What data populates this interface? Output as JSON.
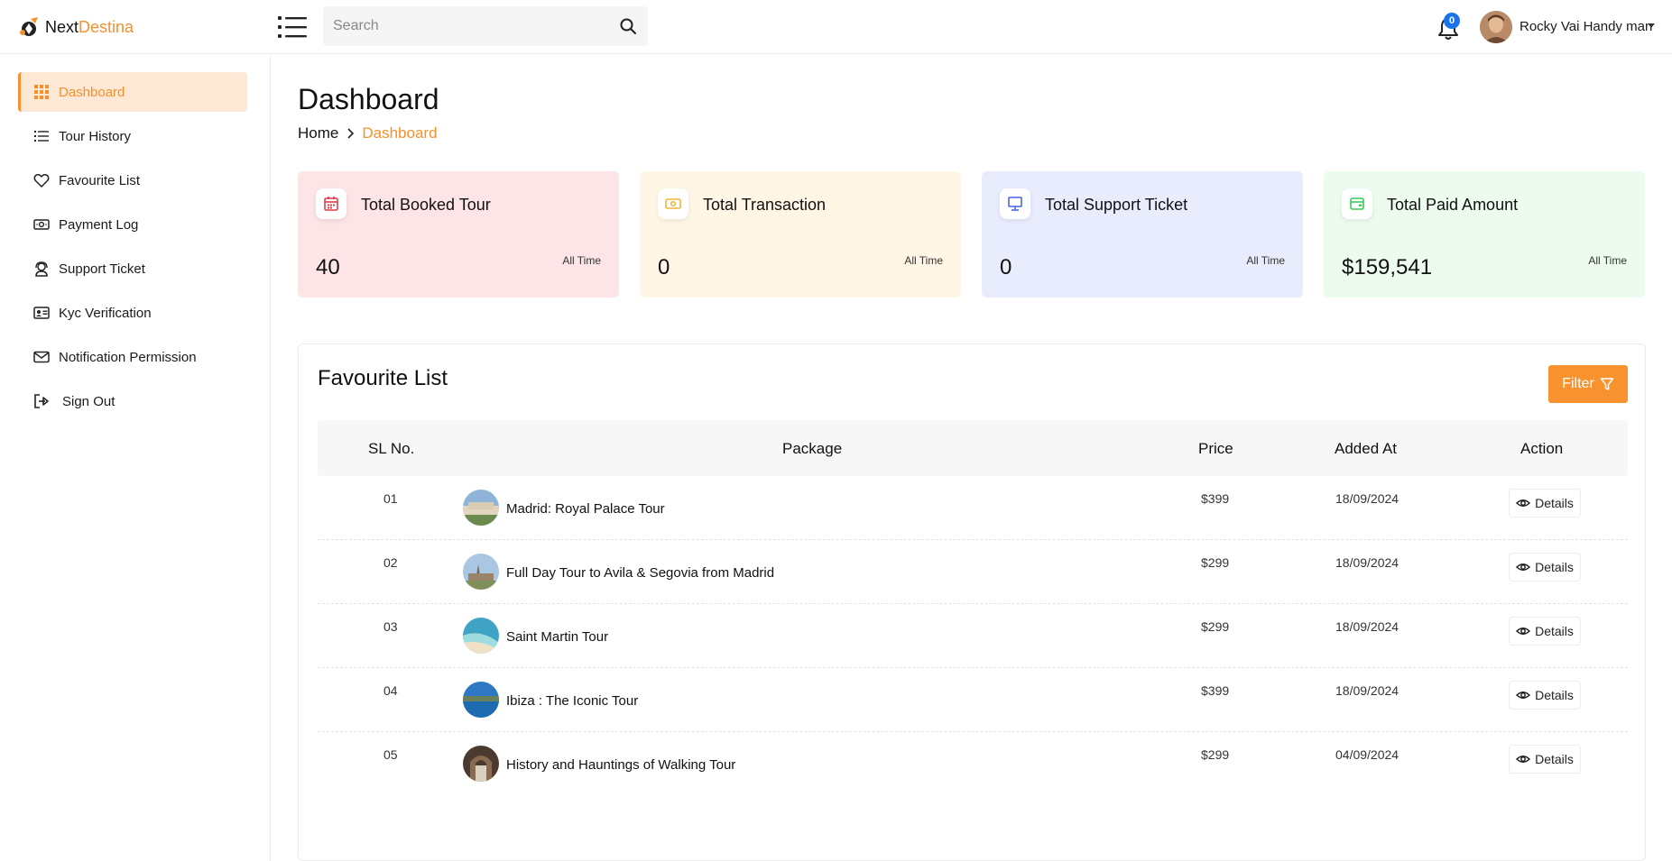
{
  "brand": {
    "part1": "Next",
    "part2": "Destina"
  },
  "search": {
    "placeholder": "Search"
  },
  "notifications": {
    "count": "0"
  },
  "user": {
    "name": "Rocky Vai Handy man"
  },
  "sidebar": {
    "items": [
      {
        "label": "Dashboard",
        "icon": "grid-icon",
        "active": true
      },
      {
        "label": "Tour History",
        "icon": "list-icon"
      },
      {
        "label": "Favourite List",
        "icon": "heart-icon"
      },
      {
        "label": "Payment Log",
        "icon": "money-icon"
      },
      {
        "label": "Support Ticket",
        "icon": "support-icon"
      },
      {
        "label": "Kyc Verification",
        "icon": "id-card-icon"
      },
      {
        "label": "Notification Permission",
        "icon": "envelope-icon"
      },
      {
        "label": "Sign Out",
        "icon": "sign-out-icon"
      }
    ]
  },
  "page": {
    "title": "Dashboard"
  },
  "breadcrumb": {
    "home": "Home",
    "current": "Dashboard"
  },
  "stats": [
    {
      "title": "Total Booked Tour",
      "value": "40",
      "period": "All Time",
      "icon": "calendar-icon",
      "bg": "#fde4e6",
      "accent": "#e03a48"
    },
    {
      "title": "Total Transaction",
      "value": "0",
      "period": "All Time",
      "icon": "cash-icon",
      "bg": "#fff6e6",
      "accent": "#f5b23c"
    },
    {
      "title": "Total Support Ticket",
      "value": "0",
      "period": "All Time",
      "icon": "monitor-icon",
      "bg": "#e8ecfd",
      "accent": "#4a63e6"
    },
    {
      "title": "Total Paid Amount",
      "value": "$159,541",
      "period": "All Time",
      "icon": "wallet-icon",
      "bg": "#ecfbee",
      "accent": "#3cc85a"
    }
  ],
  "favourites": {
    "title": "Favourite List",
    "filter_label": "Filter",
    "columns": {
      "sl": "SL No.",
      "package": "Package",
      "price": "Price",
      "added": "Added At",
      "action": "Action"
    },
    "details_label": "Details",
    "rows": [
      {
        "sl": "01",
        "package": "Madrid: Royal Palace Tour",
        "price": "$399",
        "added": "18/09/2024"
      },
      {
        "sl": "02",
        "package": "Full Day Tour to Avila & Segovia from Madrid",
        "price": "$299",
        "added": "18/09/2024"
      },
      {
        "sl": "03",
        "package": "Saint Martin Tour",
        "price": "$299",
        "added": "18/09/2024"
      },
      {
        "sl": "04",
        "package": "Ibiza : The Iconic Tour",
        "price": "$399",
        "added": "18/09/2024"
      },
      {
        "sl": "05",
        "package": "History and Hauntings of Walking Tour",
        "price": "$299",
        "added": "04/09/2024"
      }
    ]
  }
}
